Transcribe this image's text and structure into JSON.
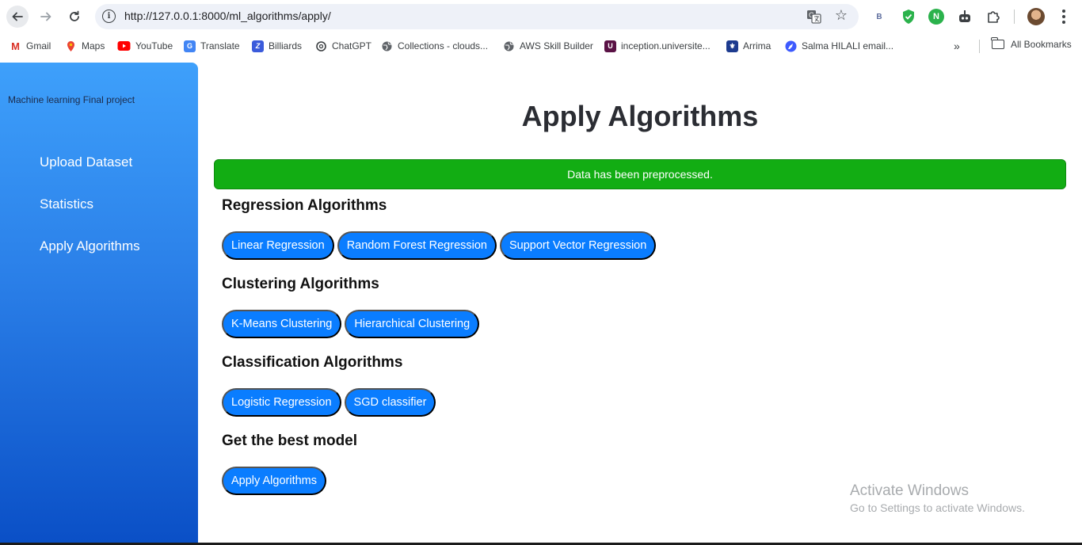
{
  "browser": {
    "url": "http://127.0.0.1:8000/ml_algorithms/apply/",
    "extension_b_label": "B",
    "extension_n_label": "N",
    "bookmarks": [
      {
        "label": "Gmail",
        "icon": "gmail-icon"
      },
      {
        "label": "Maps",
        "icon": "maps-icon"
      },
      {
        "label": "YouTube",
        "icon": "youtube-icon"
      },
      {
        "label": "Translate",
        "icon": "translate-icon"
      },
      {
        "label": "Billiards",
        "icon": "billiards-icon"
      },
      {
        "label": "ChatGPT",
        "icon": "chatgpt-icon"
      },
      {
        "label": "Collections - clouds...",
        "icon": "globe-icon"
      },
      {
        "label": "AWS Skill Builder",
        "icon": "globe-icon"
      },
      {
        "label": "inception.universite...",
        "icon": "u-icon"
      },
      {
        "label": "Arrima",
        "icon": "arrima-icon"
      },
      {
        "label": "Salma HILALI email...",
        "icon": "rocket-icon"
      }
    ],
    "more_bookmarks": "»",
    "all_bookmarks_label": "All Bookmarks"
  },
  "sidebar": {
    "project_title": "Machine learning Final project",
    "items": [
      {
        "label": "Upload Dataset"
      },
      {
        "label": "Statistics"
      },
      {
        "label": "Apply Algorithms"
      }
    ]
  },
  "main": {
    "title": "Apply Algorithms",
    "alert": "Data has been preprocessed.",
    "sections": [
      {
        "heading": "Regression Algorithms",
        "buttons": [
          "Linear Regression",
          "Random Forest Regression",
          "Support Vector Regression"
        ]
      },
      {
        "heading": "Clustering Algorithms",
        "buttons": [
          "K-Means Clustering",
          "Hierarchical Clustering"
        ]
      },
      {
        "heading": "Classification Algorithms",
        "buttons": [
          "Logistic Regression",
          "SGD classifier"
        ]
      },
      {
        "heading": "Get the best model",
        "buttons": [
          "Apply Algorithms"
        ]
      }
    ]
  },
  "watermark": {
    "title": "Activate Windows",
    "subtitle": "Go to Settings to activate Windows."
  },
  "colors": {
    "accent": "#0a7dff",
    "alert_green": "#12ad13",
    "sidebar_top": "#3ea0fb",
    "sidebar_bottom": "#0a4fc6"
  }
}
